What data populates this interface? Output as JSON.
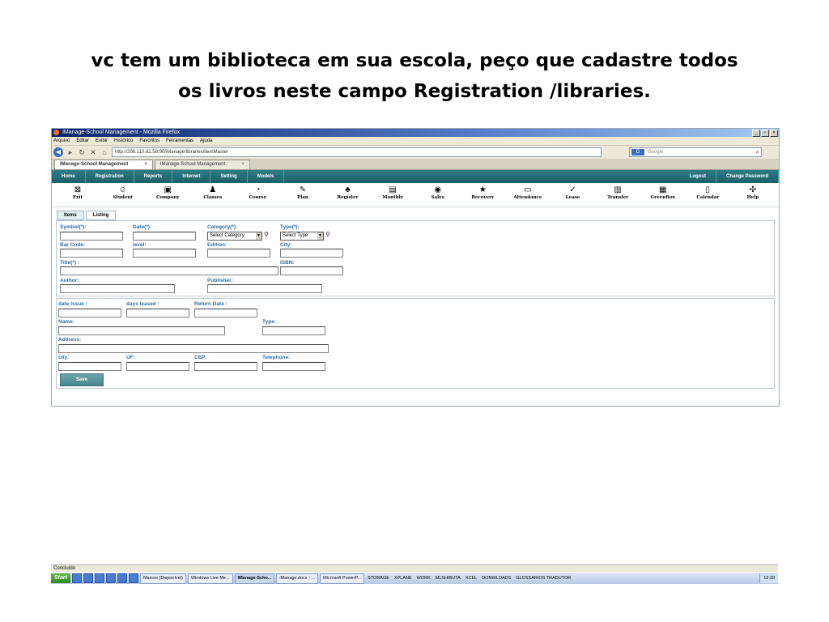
{
  "slide": {
    "title_line1": "vc tem um biblioteca em sua escola, peço que cadastre todos",
    "title_line2": "os livros neste campo Registration /libraries."
  },
  "browser": {
    "window_title": "IManage-School Management - Mozilla Firefox",
    "menu": [
      "Arquivo",
      "Editar",
      "Exibir",
      "Histórico",
      "Favoritos",
      "Ferramentas",
      "Ajuda"
    ],
    "url": "http://208.110.82.58:90/iManage/libraries/itemMaster",
    "search_placeholder": "Google",
    "tabs": [
      {
        "label": "IManage-School Management",
        "close": "×"
      },
      {
        "label": "IManage-School Management",
        "close": "×"
      }
    ],
    "status_text": "Concluído"
  },
  "app": {
    "nav_left": [
      "Home",
      "Registration",
      "Reports",
      "Internet",
      "Setting",
      "Models"
    ],
    "nav_right": [
      "Logout",
      "Change Password"
    ],
    "toolbar": [
      {
        "label": "Exit",
        "icon": "⊠"
      },
      {
        "label": "Student",
        "icon": "☺"
      },
      {
        "label": "Company",
        "icon": "▣"
      },
      {
        "label": "Classes",
        "icon": "♟"
      },
      {
        "label": "Course",
        "icon": "◔"
      },
      {
        "label": "Plan",
        "icon": "✎"
      },
      {
        "label": "Register",
        "icon": "♣"
      },
      {
        "label": "Monthly",
        "icon": "▤"
      },
      {
        "label": "Sales",
        "icon": "◉"
      },
      {
        "label": "Recovery",
        "icon": "★"
      },
      {
        "label": "Attendance",
        "icon": "▭"
      },
      {
        "label": "Lease",
        "icon": "✓"
      },
      {
        "label": "Transfer",
        "icon": "▥"
      },
      {
        "label": "GreenBox",
        "icon": "▦"
      },
      {
        "label": "Calendar",
        "icon": "▯"
      },
      {
        "label": "Help",
        "icon": "✣"
      }
    ],
    "form_tabs": [
      "Items",
      "Listing"
    ],
    "fields": {
      "symbol": "Symbol(*):",
      "date": "Date(*):",
      "category": "Category(*):",
      "category_value": "Select Category",
      "type": "Type(*):",
      "type_value": "Select Type",
      "barcode": "Bar Code:",
      "level": "level:",
      "edition": "Edition:",
      "city": "City:",
      "title": "Title(*) :",
      "isbn": "ISBN:",
      "author": "Author:",
      "publisher": "Publisher:"
    },
    "loan": {
      "date_issue": "date Issue :",
      "days_leased": "days leased :",
      "return_date": "Return Date :",
      "name": "Name:",
      "type": "Type:",
      "address": "Address:",
      "city": "city:",
      "uf": "UF:",
      "cep": "CEP:",
      "telephone": "Telephone:"
    },
    "save_label": "Save"
  },
  "taskbar": {
    "start": "Start",
    "items": [
      "Marcos (Disponível)",
      "Windows Live Me...",
      "IManage-Scho...",
      "iManage.docx - ...",
      "Microsoft PowerP..."
    ],
    "toolbars": [
      "STORAGE",
      "XPLANE",
      "WORK",
      "MLSHIBUTA",
      "XCEL",
      "DONWLOADS",
      "GLOSSARIOS TRADUTOR"
    ],
    "clock": "13:39"
  }
}
